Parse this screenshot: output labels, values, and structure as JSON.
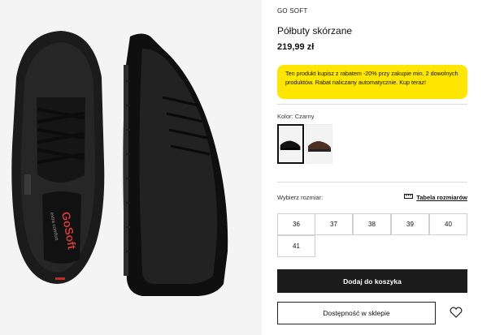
{
  "product": {
    "brand": "GO SOFT",
    "name": "Półbuty skórzane",
    "price": "219,99 zł"
  },
  "promo": {
    "text": "Ten produkt kupisz z rabatem -20% przy zakupie min. 2 dowolnych produktów. Rabat naliczany automatycznie. Kup teraz!",
    "background": "#ffe600"
  },
  "color": {
    "label": "Kolor:",
    "value": "Czarny",
    "swatches": [
      "black-shoe",
      "brown-shoe"
    ]
  },
  "size": {
    "label": "Wybierz rozmiar:",
    "guide_label": "Tabela rozmiarów",
    "options": [
      "36",
      "37",
      "38",
      "39",
      "40",
      "41"
    ]
  },
  "actions": {
    "add_to_cart": "Dodaj do koszyka",
    "store_availability": "Dostępność w sklepie",
    "wishlist_icon": "heart-icon"
  },
  "gallery": {
    "logo_text": "GoSoft",
    "logo_tagline": "extra comfort"
  },
  "colors": {
    "accent": "#ffe600",
    "button": "#1c1c1c"
  }
}
